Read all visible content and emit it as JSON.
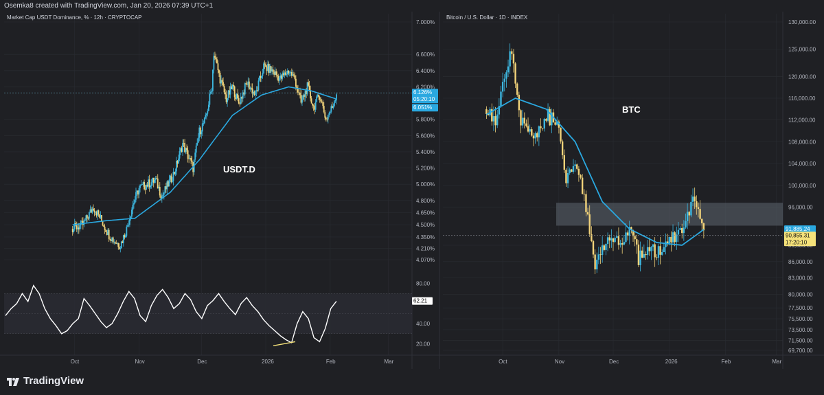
{
  "header": {
    "created_text": "Osemka8 created with TradingView.com, Jan 20, 2026 07:39 UTC+1"
  },
  "footer": {
    "brand": "TradingView"
  },
  "left_panel": {
    "symbol_label": "Market Cap USDT Dominance, % · 12h · CRYPTOCAP",
    "annotation": "USDT.D",
    "x_ticks": [
      "Oct",
      "Nov",
      "Dec",
      "2026",
      "Feb",
      "Mar"
    ],
    "y_ticks": [
      "7.000%",
      "6.600%",
      "6.400%",
      "6.200%",
      "5.800%",
      "5.600%",
      "5.400%",
      "5.200%",
      "5.000%",
      "4.800%",
      "4.650%",
      "4.500%",
      "4.350%",
      "4.210%",
      "4.070%"
    ],
    "badges": {
      "price": "6.126%",
      "countdown": "05:20:10",
      "ma": "6.051%",
      "rsi": "62.21"
    },
    "rsi_ticks": [
      "80.00",
      "40.00",
      "20.00"
    ]
  },
  "right_panel": {
    "symbol_label": "Bitcoin / U.S. Dollar · 1D · INDEX",
    "annotation": "BTC",
    "x_ticks": [
      "Oct",
      "Nov",
      "Dec",
      "2026",
      "Feb",
      "Mar"
    ],
    "y_ticks": [
      "130,000.00",
      "125,000.00",
      "120,000.00",
      "116,000.00",
      "112,000.00",
      "108,000.00",
      "104,000.00",
      "100,000.00",
      "96,000.00",
      "89,000.00",
      "86,000.00",
      "83,000.00",
      "80,000.00",
      "77,500.00",
      "75,500.00",
      "73,500.00",
      "71,500.00",
      "69,700.00"
    ],
    "badges": {
      "ma": "91,885.24",
      "price": "90,855.31",
      "countdown": "17:20:10"
    }
  },
  "colors": {
    "bg": "#1f2024",
    "grid": "#2a2c32",
    "up": "#3db7e0",
    "down": "#f2d37a",
    "ma": "#2aa8e0",
    "rsi": "#ffffff",
    "axis_text": "#b2b5be"
  },
  "chart_data": [
    {
      "type": "candlestick",
      "title": "Market Cap USDT Dominance, % · 12h · CRYPTOCAP",
      "x_axis_ticks": [
        "Oct",
        "Nov",
        "Dec",
        "2026",
        "Feb",
        "Mar"
      ],
      "ylim": [
        3.95,
        7.05
      ],
      "ma_overlay": true,
      "close_path": [
        {
          "x": "Sep 15",
          "y": 4.45
        },
        {
          "x": "Sep 20",
          "y": 4.5
        },
        {
          "x": "Sep 25",
          "y": 4.72
        },
        {
          "x": "Sep 28",
          "y": 4.6
        },
        {
          "x": "Oct 2",
          "y": 4.4
        },
        {
          "x": "Oct 5",
          "y": 4.3
        },
        {
          "x": "Oct 8",
          "y": 4.25
        },
        {
          "x": "Oct 11",
          "y": 4.45
        },
        {
          "x": "Oct 14",
          "y": 4.75
        },
        {
          "x": "Oct 17",
          "y": 4.95
        },
        {
          "x": "Oct 21",
          "y": 5.0
        },
        {
          "x": "Oct 25",
          "y": 5.05
        },
        {
          "x": "Oct 28",
          "y": 4.85
        },
        {
          "x": "Oct 31",
          "y": 5.0
        },
        {
          "x": "Nov 3",
          "y": 5.15
        },
        {
          "x": "Nov 7",
          "y": 5.5
        },
        {
          "x": "Nov 12",
          "y": 5.2
        },
        {
          "x": "Nov 15",
          "y": 5.65
        },
        {
          "x": "Nov 18",
          "y": 5.8
        },
        {
          "x": "Nov 21",
          "y": 6.2
        },
        {
          "x": "Nov 22",
          "y": 6.62
        },
        {
          "x": "Nov 25",
          "y": 6.3
        },
        {
          "x": "Nov 28",
          "y": 6.05
        },
        {
          "x": "Dec 1",
          "y": 6.2
        },
        {
          "x": "Dec 4",
          "y": 6.0
        },
        {
          "x": "Dec 8",
          "y": 6.25
        },
        {
          "x": "Dec 12",
          "y": 6.1
        },
        {
          "x": "Dec 16",
          "y": 6.45
        },
        {
          "x": "Dec 20",
          "y": 6.4
        },
        {
          "x": "Dec 24",
          "y": 6.3
        },
        {
          "x": "Dec 28",
          "y": 6.4
        },
        {
          "x": "Dec 31",
          "y": 6.3
        },
        {
          "x": "Jan 3",
          "y": 6.0
        },
        {
          "x": "Jan 6",
          "y": 6.2
        },
        {
          "x": "Jan 9",
          "y": 5.95
        },
        {
          "x": "Jan 12",
          "y": 6.1
        },
        {
          "x": "Jan 15",
          "y": 5.8
        },
        {
          "x": "Jan 18",
          "y": 5.95
        },
        {
          "x": "Jan 20",
          "y": 6.126
        }
      ],
      "ma_path": [
        {
          "x": "Sep 15",
          "y": 4.5
        },
        {
          "x": "Oct 1",
          "y": 4.55
        },
        {
          "x": "Oct 15",
          "y": 4.58
        },
        {
          "x": "Nov 1",
          "y": 4.9
        },
        {
          "x": "Nov 15",
          "y": 5.3
        },
        {
          "x": "Dec 1",
          "y": 5.85
        },
        {
          "x": "Dec 15",
          "y": 6.1
        },
        {
          "x": "Dec 28",
          "y": 6.2
        },
        {
          "x": "Jan 8",
          "y": 6.15
        },
        {
          "x": "Jan 20",
          "y": 6.051
        }
      ],
      "last_price": 6.126,
      "ma_value": 6.051
    },
    {
      "type": "line",
      "title": "RSI",
      "ylim": [
        10,
        90
      ],
      "bands": [
        30,
        70
      ],
      "y_ticks": [
        80,
        40,
        20
      ],
      "values": [
        48,
        55,
        60,
        70,
        62,
        78,
        70,
        55,
        45,
        38,
        30,
        33,
        40,
        45,
        65,
        58,
        50,
        42,
        36,
        40,
        50,
        62,
        72,
        65,
        48,
        42,
        58,
        68,
        74,
        66,
        55,
        60,
        70,
        64,
        52,
        45,
        58,
        63,
        70,
        62,
        55,
        49,
        60,
        66,
        58,
        52,
        44,
        38,
        33,
        28,
        24,
        21,
        40,
        52,
        45,
        26,
        22,
        35,
        55,
        62.21
      ],
      "divergence_line": true,
      "last_value": 62.21
    },
    {
      "type": "candlestick",
      "title": "Bitcoin / U.S. Dollar · 1D · INDEX",
      "x_axis_ticks": [
        "Oct",
        "Nov",
        "Dec",
        "2026",
        "Feb",
        "Mar"
      ],
      "ylim": [
        69000,
        131000
      ],
      "ma_overlay": true,
      "support_zone": [
        94400,
        96000
      ],
      "close_path": [
        {
          "x": "Sep 22",
          "y": 114000
        },
        {
          "x": "Sep 27",
          "y": 111500
        },
        {
          "x": "Oct 2",
          "y": 120000
        },
        {
          "x": "Oct 6",
          "y": 124500
        },
        {
          "x": "Oct 10",
          "y": 113000
        },
        {
          "x": "Oct 14",
          "y": 111000
        },
        {
          "x": "Oct 20",
          "y": 109000
        },
        {
          "x": "Oct 26",
          "y": 113000
        },
        {
          "x": "Nov 1",
          "y": 110000
        },
        {
          "x": "Nov 5",
          "y": 101500
        },
        {
          "x": "Nov 10",
          "y": 105000
        },
        {
          "x": "Nov 14",
          "y": 99500
        },
        {
          "x": "Nov 18",
          "y": 92500
        },
        {
          "x": "Nov 21",
          "y": 84500
        },
        {
          "x": "Nov 25",
          "y": 87500
        },
        {
          "x": "Nov 30",
          "y": 91000
        },
        {
          "x": "Dec 5",
          "y": 89500
        },
        {
          "x": "Dec 10",
          "y": 92500
        },
        {
          "x": "Dec 15",
          "y": 86500
        },
        {
          "x": "Dec 20",
          "y": 88000
        },
        {
          "x": "Dec 25",
          "y": 87500
        },
        {
          "x": "Dec 30",
          "y": 88500
        },
        {
          "x": "Jan 3",
          "y": 90500
        },
        {
          "x": "Jan 8",
          "y": 91000
        },
        {
          "x": "Jan 14",
          "y": 96500
        },
        {
          "x": "Jan 17",
          "y": 95200
        },
        {
          "x": "Jan 20",
          "y": 90855
        }
      ],
      "ma_path": [
        {
          "x": "Sep 22",
          "y": 113000
        },
        {
          "x": "Oct 8",
          "y": 116000
        },
        {
          "x": "Oct 25",
          "y": 114000
        },
        {
          "x": "Nov 10",
          "y": 108000
        },
        {
          "x": "Nov 25",
          "y": 97000
        },
        {
          "x": "Dec 10",
          "y": 92000
        },
        {
          "x": "Dec 25",
          "y": 89500
        },
        {
          "x": "Jan 8",
          "y": 89000
        },
        {
          "x": "Jan 20",
          "y": 91885
        }
      ],
      "last_price": 90855.31,
      "ma_value": 91885.24
    }
  ]
}
